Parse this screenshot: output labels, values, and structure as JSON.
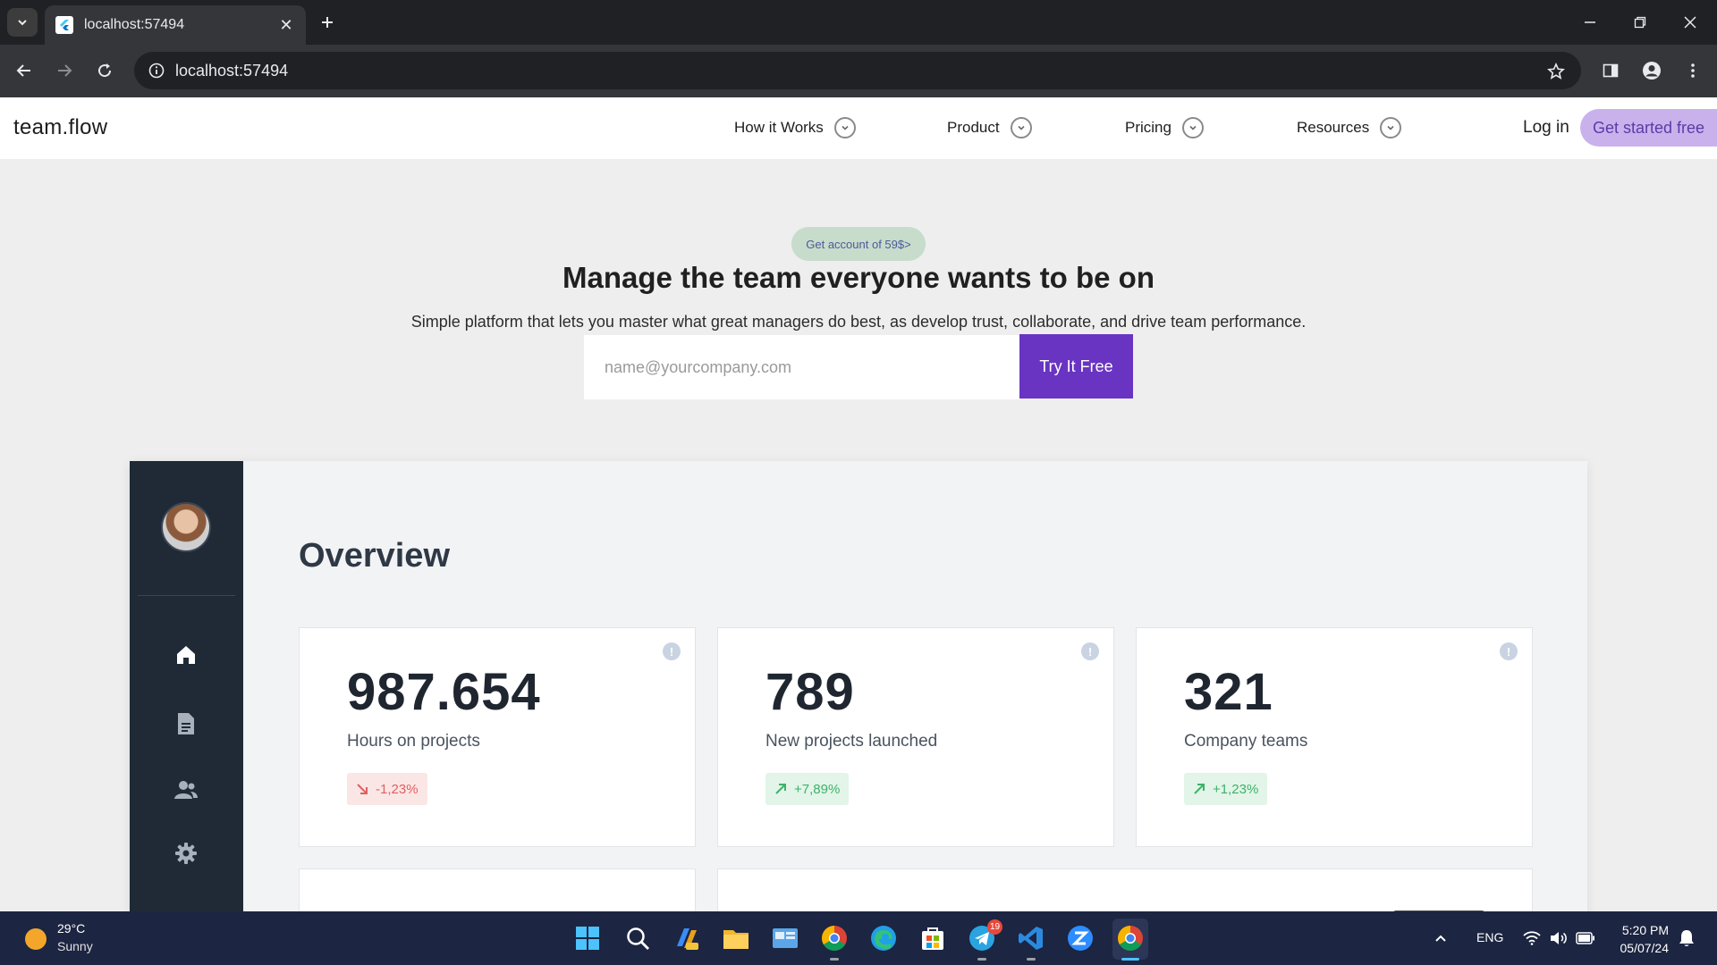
{
  "browser": {
    "tab_title": "localhost:57494",
    "url": "localhost:57494"
  },
  "site": {
    "logo": "team.flow",
    "nav": [
      {
        "label": "How it Works"
      },
      {
        "label": "Product"
      },
      {
        "label": "Pricing"
      },
      {
        "label": "Resources"
      }
    ],
    "login_label": "Log in",
    "cta_label": "Get started free"
  },
  "hero": {
    "badge": "Get account of 59$>",
    "title": "Manage the team everyone wants to be on",
    "subtitle": "Simple platform that lets you master what great managers do best, as develop trust, collaborate, and drive team performance.",
    "email_placeholder": "name@yourcompany.com",
    "email_value": "",
    "button_label": "Try It Free"
  },
  "dashboard": {
    "title": "Overview",
    "sidebar_icons": [
      "home-icon",
      "document-icon",
      "users-icon",
      "settings-icon"
    ],
    "stats": [
      {
        "value": "987.654",
        "label": "Hours on projects",
        "delta": "-1,23%",
        "trend": "down"
      },
      {
        "value": "789",
        "label": "New projects launched",
        "delta": "+7,89%",
        "trend": "up"
      },
      {
        "value": "321",
        "label": "Company teams",
        "delta": "+1,23%",
        "trend": "up"
      }
    ],
    "info_glyph": "!"
  },
  "taskbar": {
    "weather_temp": "29°C",
    "weather_condition": "Sunny",
    "telegram_badge": "19",
    "language": "ENG",
    "time": "5:20 PM",
    "date": "05/07/24"
  },
  "colors": {
    "accent": "#6a34c2",
    "cta_bg": "#c9b2ec",
    "sidebar_bg": "#1f2a36",
    "negative": "#e06060",
    "positive": "#3fb16a"
  }
}
